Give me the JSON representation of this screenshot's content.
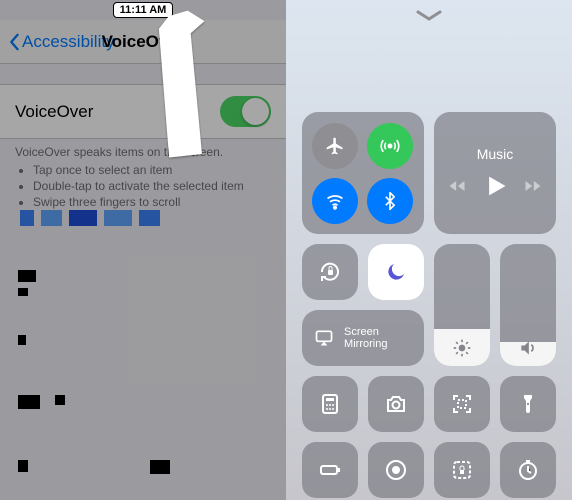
{
  "left": {
    "time": "11:11 AM",
    "back_label": "Accessibility",
    "title": "VoiceOver",
    "switch_label": "VoiceOver",
    "switch_on": true,
    "desc_intro": "VoiceOver speaks items on the screen.",
    "desc_items": [
      "Tap once to select an item",
      "Double-tap to activate the selected item",
      "Swipe three fingers to scroll"
    ]
  },
  "cc": {
    "music_label": "Music",
    "mirror_label": "Screen Mirroring",
    "brightness_pct": 30,
    "volume_pct": 20,
    "connectivity": {
      "airplane": false,
      "cellular": true,
      "wifi": true,
      "bluetooth": true
    }
  }
}
